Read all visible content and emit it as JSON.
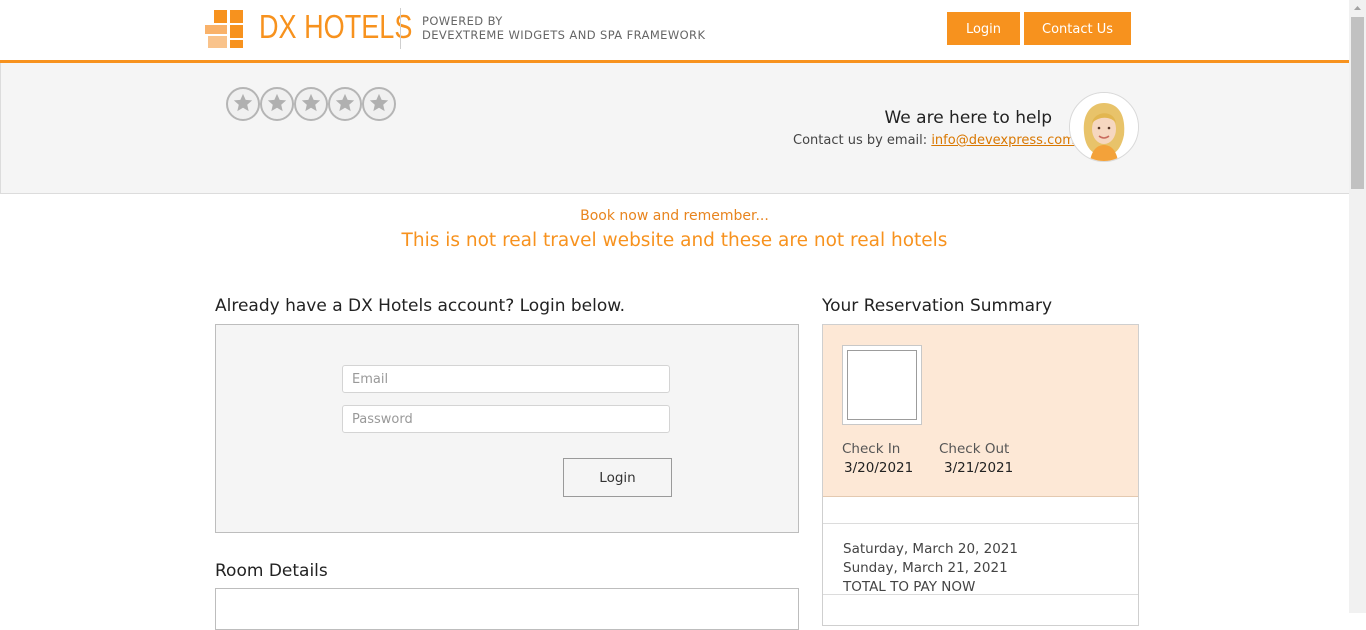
{
  "header": {
    "logo_text": "DX HOTELS",
    "powered_line1": "POWERED BY",
    "powered_line2": "DEVEXTREME WIDGETS AND SPA FRAMEWORK",
    "login_label": "Login",
    "contact_label": "Contact Us"
  },
  "help": {
    "rating_stars": 5,
    "title": "We are here to help",
    "sub_prefix": "Contact us by email:",
    "email": "info@devexpress.com"
  },
  "banner": {
    "line1": "Book now and remember...",
    "line2": "This is not real travel website and these are not real hotels"
  },
  "login": {
    "title": "Already have a DX Hotels account? Login below.",
    "email_placeholder": "Email",
    "password_placeholder": "Password",
    "button_label": "Login"
  },
  "room": {
    "title": "Room Details"
  },
  "reservation": {
    "title": "Your Reservation Summary",
    "check_in_label": "Check In",
    "check_in_value": "3/20/2021",
    "check_out_label": "Check Out",
    "check_out_value": "3/21/2021",
    "date_from": "Saturday, March 20, 2021",
    "date_to": "Sunday, March 21, 2021",
    "total_label": "TOTAL TO PAY NOW"
  },
  "colors": {
    "accent": "#f7921e",
    "band_bg": "#f5f5f5",
    "summary_bg": "#fde8d6"
  }
}
